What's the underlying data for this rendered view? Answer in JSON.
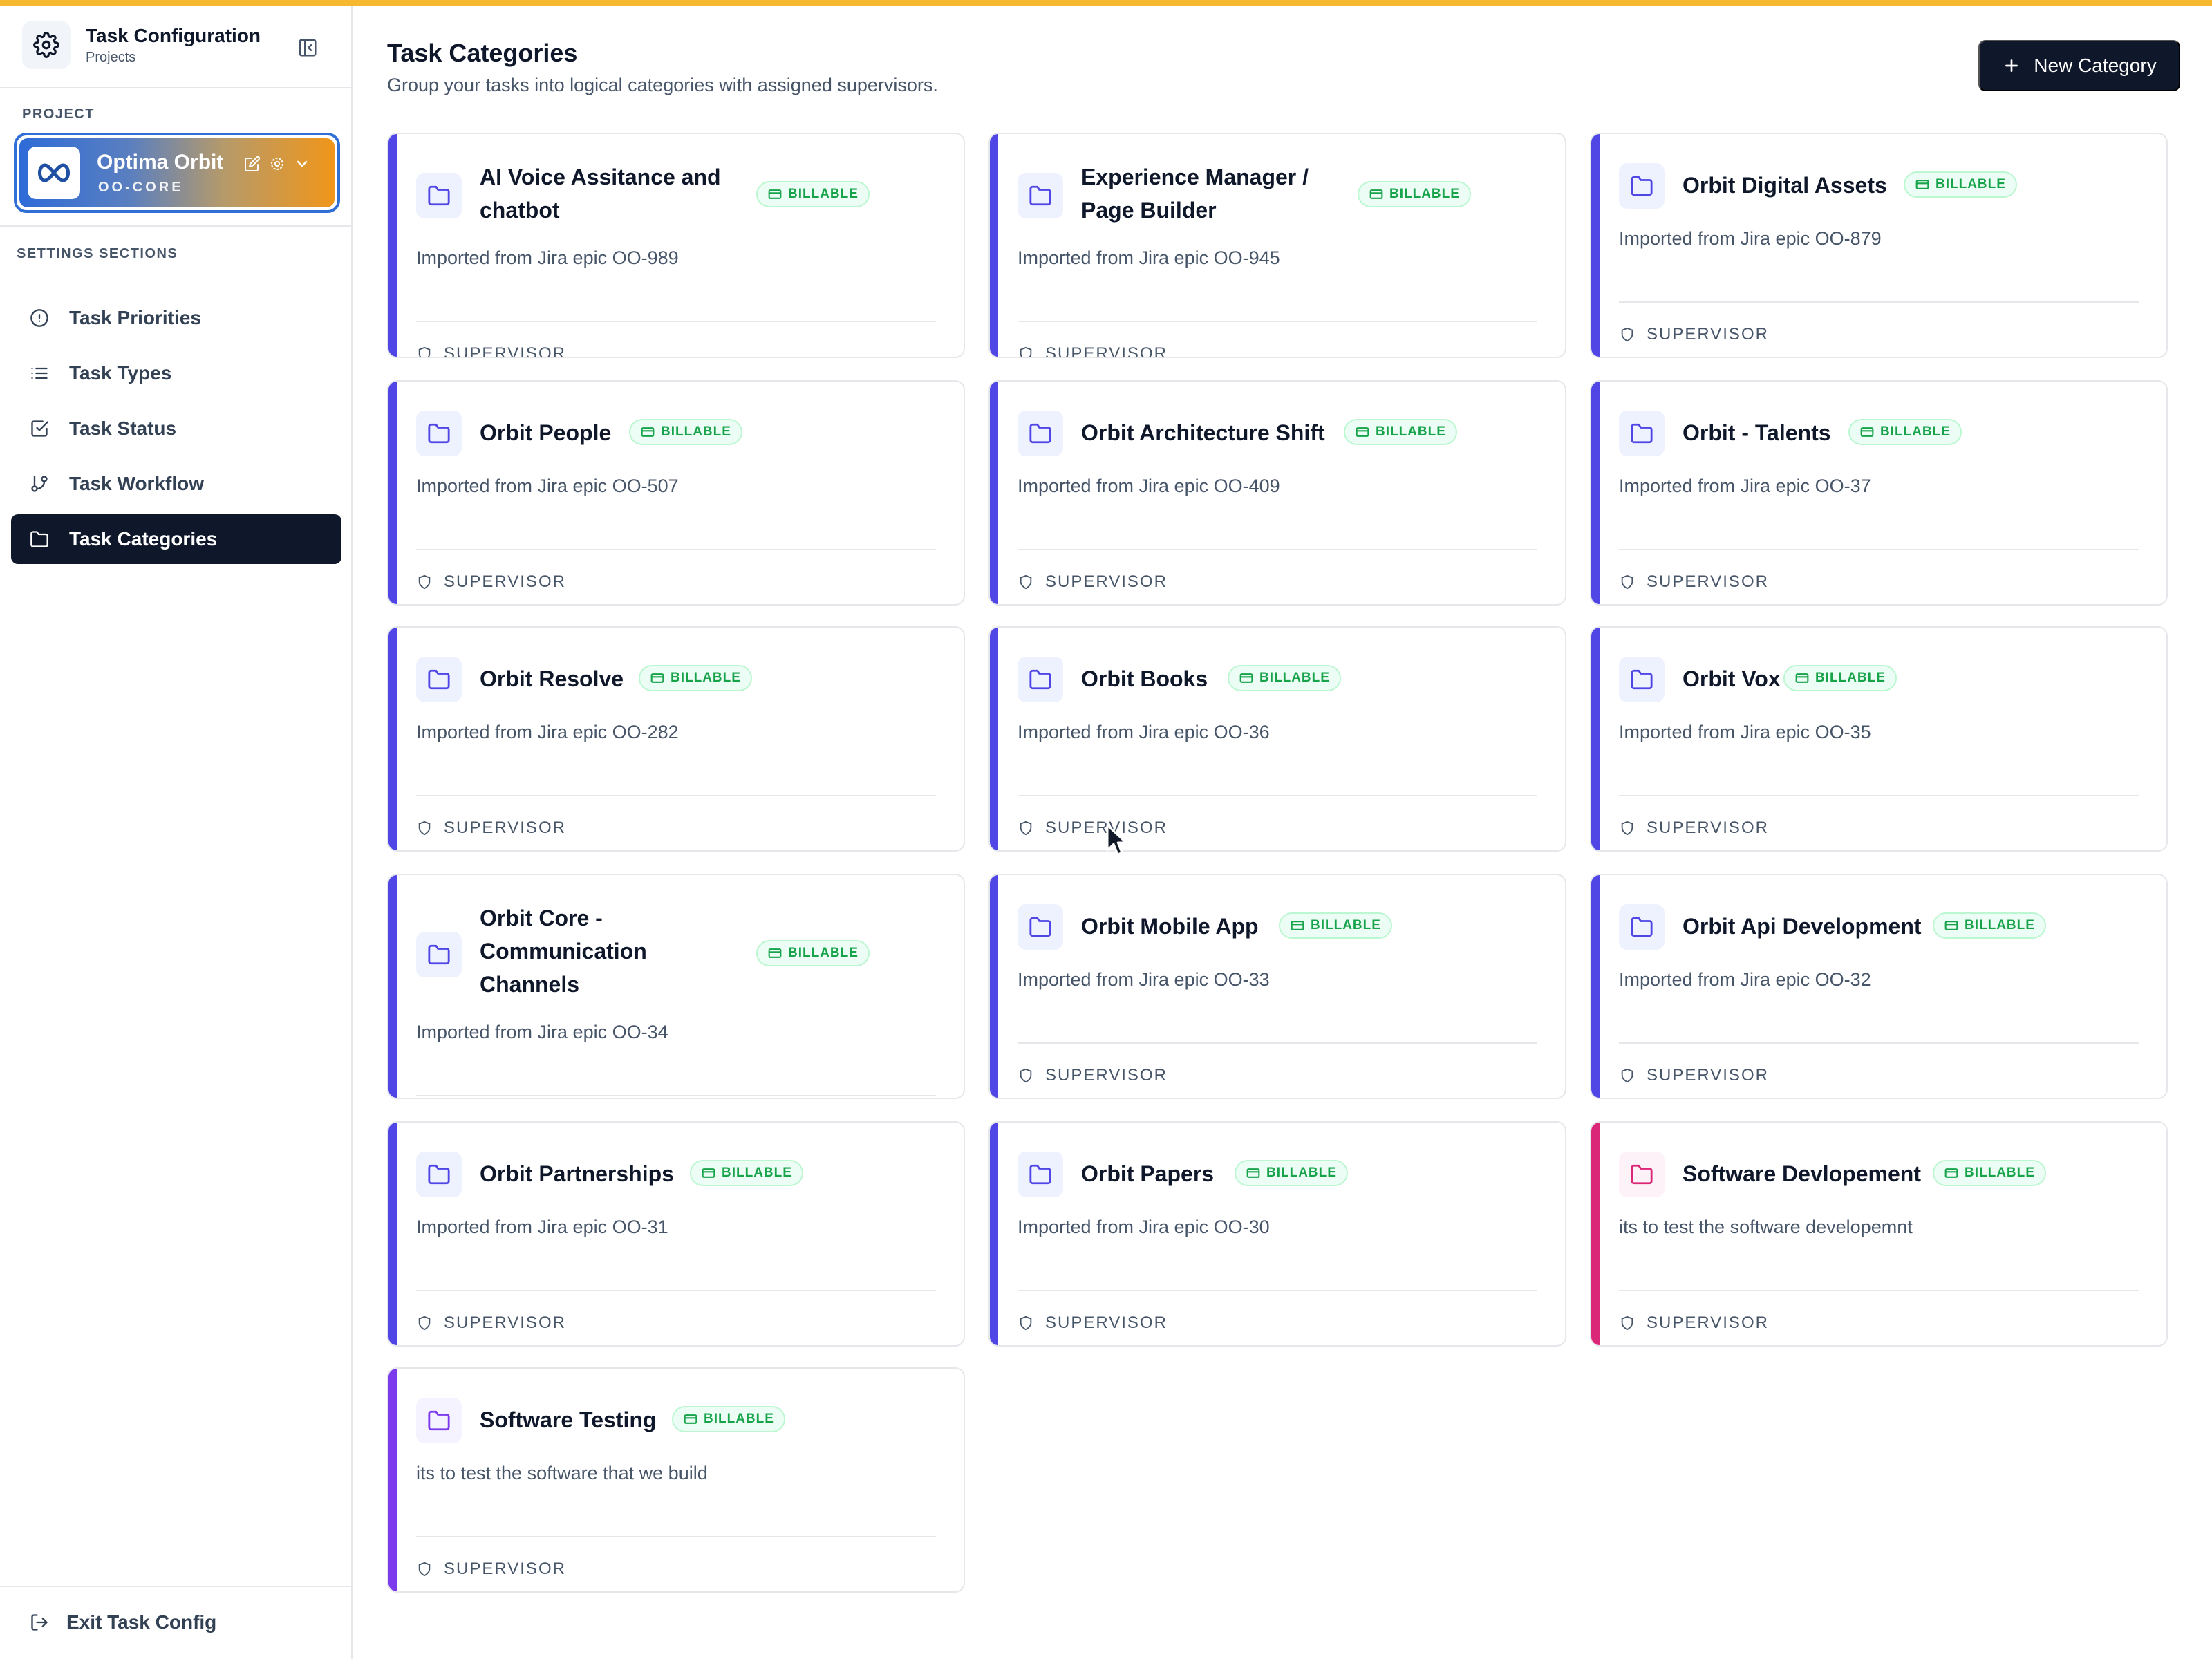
{
  "sidebar": {
    "title": "Task Configuration",
    "subtitle": "Projects",
    "project_label": "PROJECT",
    "project": {
      "name": "Optima Orbit",
      "code": "OO-CORE"
    },
    "sections_label": "SETTINGS SECTIONS",
    "items": [
      {
        "label": "Task Priorities",
        "icon": "alert-circle-icon"
      },
      {
        "label": "Task Types",
        "icon": "list-icon"
      },
      {
        "label": "Task Status",
        "icon": "checkbox-icon"
      },
      {
        "label": "Task Workflow",
        "icon": "git-branch-icon"
      },
      {
        "label": "Task Categories",
        "icon": "folder-icon",
        "active": true
      }
    ],
    "exit_label": "Exit Task Config"
  },
  "header": {
    "title": "Task Categories",
    "description": "Group your tasks into logical categories with assigned supervisors.",
    "new_button": "New Category"
  },
  "badge_label": "BILLABLE",
  "supervisor_label": "SUPERVISOR",
  "colors": {
    "accent_indigo": "#4f46e5",
    "accent_pink": "#db2777",
    "accent_purple": "#7c3aed",
    "billable_green": "#16a34a",
    "primary_dark": "#0f172a",
    "top_bar": "#f5b82e"
  },
  "categories": [
    {
      "title": "AI Voice Assitance and chatbot",
      "description": "Imported from Jira epic OO-989"
    },
    {
      "title": "Experience Manager / Page Builder",
      "description": "Imported from Jira epic OO-945"
    },
    {
      "title": "Orbit Digital Assets",
      "description": "Imported from Jira epic OO-879"
    },
    {
      "title": "Orbit People",
      "description": "Imported from Jira epic OO-507"
    },
    {
      "title": "Orbit Architecture Shift",
      "description": "Imported from Jira epic OO-409"
    },
    {
      "title": "Orbit - Talents",
      "description": "Imported from Jira epic OO-37"
    },
    {
      "title": "Orbit Resolve",
      "description": "Imported from Jira epic OO-282"
    },
    {
      "title": "Orbit Books",
      "description": "Imported from Jira epic OO-36"
    },
    {
      "title": "Orbit Vox",
      "description": "Imported from Jira epic OO-35"
    },
    {
      "title": "Orbit Core - Communication Channels",
      "description": "Imported from Jira epic OO-34"
    },
    {
      "title": "Orbit Mobile App",
      "description": "Imported from Jira epic OO-33"
    },
    {
      "title": "Orbit Api Development",
      "description": "Imported from Jira epic OO-32"
    },
    {
      "title": "Orbit Partnerships",
      "description": "Imported from Jira epic OO-31"
    },
    {
      "title": "Orbit Papers",
      "description": "Imported from Jira epic OO-30"
    },
    {
      "title": "Software Devlopement",
      "description": "its to test the software developemnt"
    },
    {
      "title": "Software Testing",
      "description": "its to test the software that we build"
    }
  ]
}
